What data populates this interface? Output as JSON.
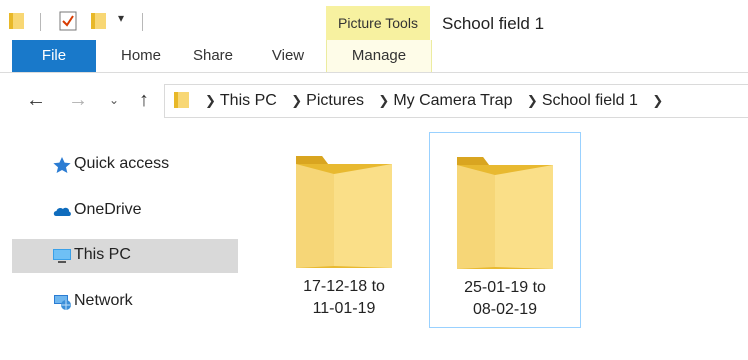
{
  "title_bar": {
    "picture_tools_label": "Picture Tools",
    "window_title": "School field 1"
  },
  "ribbon": {
    "tabs": [
      {
        "label": "File"
      },
      {
        "label": "Home"
      },
      {
        "label": "Share"
      },
      {
        "label": "View"
      },
      {
        "label": "Manage"
      }
    ]
  },
  "address": {
    "breadcrumbs": [
      "This PC",
      "Pictures",
      "My Camera Trap",
      "School field 1"
    ]
  },
  "sidebar": {
    "items": [
      {
        "label": "Quick access",
        "icon": "star-icon"
      },
      {
        "label": "OneDrive",
        "icon": "cloud-icon"
      },
      {
        "label": "This PC",
        "icon": "computer-icon"
      },
      {
        "label": "Network",
        "icon": "network-icon"
      }
    ]
  },
  "content": {
    "folders": [
      {
        "name_line1": "17-12-18 to",
        "name_line2": "11-01-19"
      },
      {
        "name_line1": "25-01-19 to",
        "name_line2": "08-02-19"
      }
    ]
  }
}
